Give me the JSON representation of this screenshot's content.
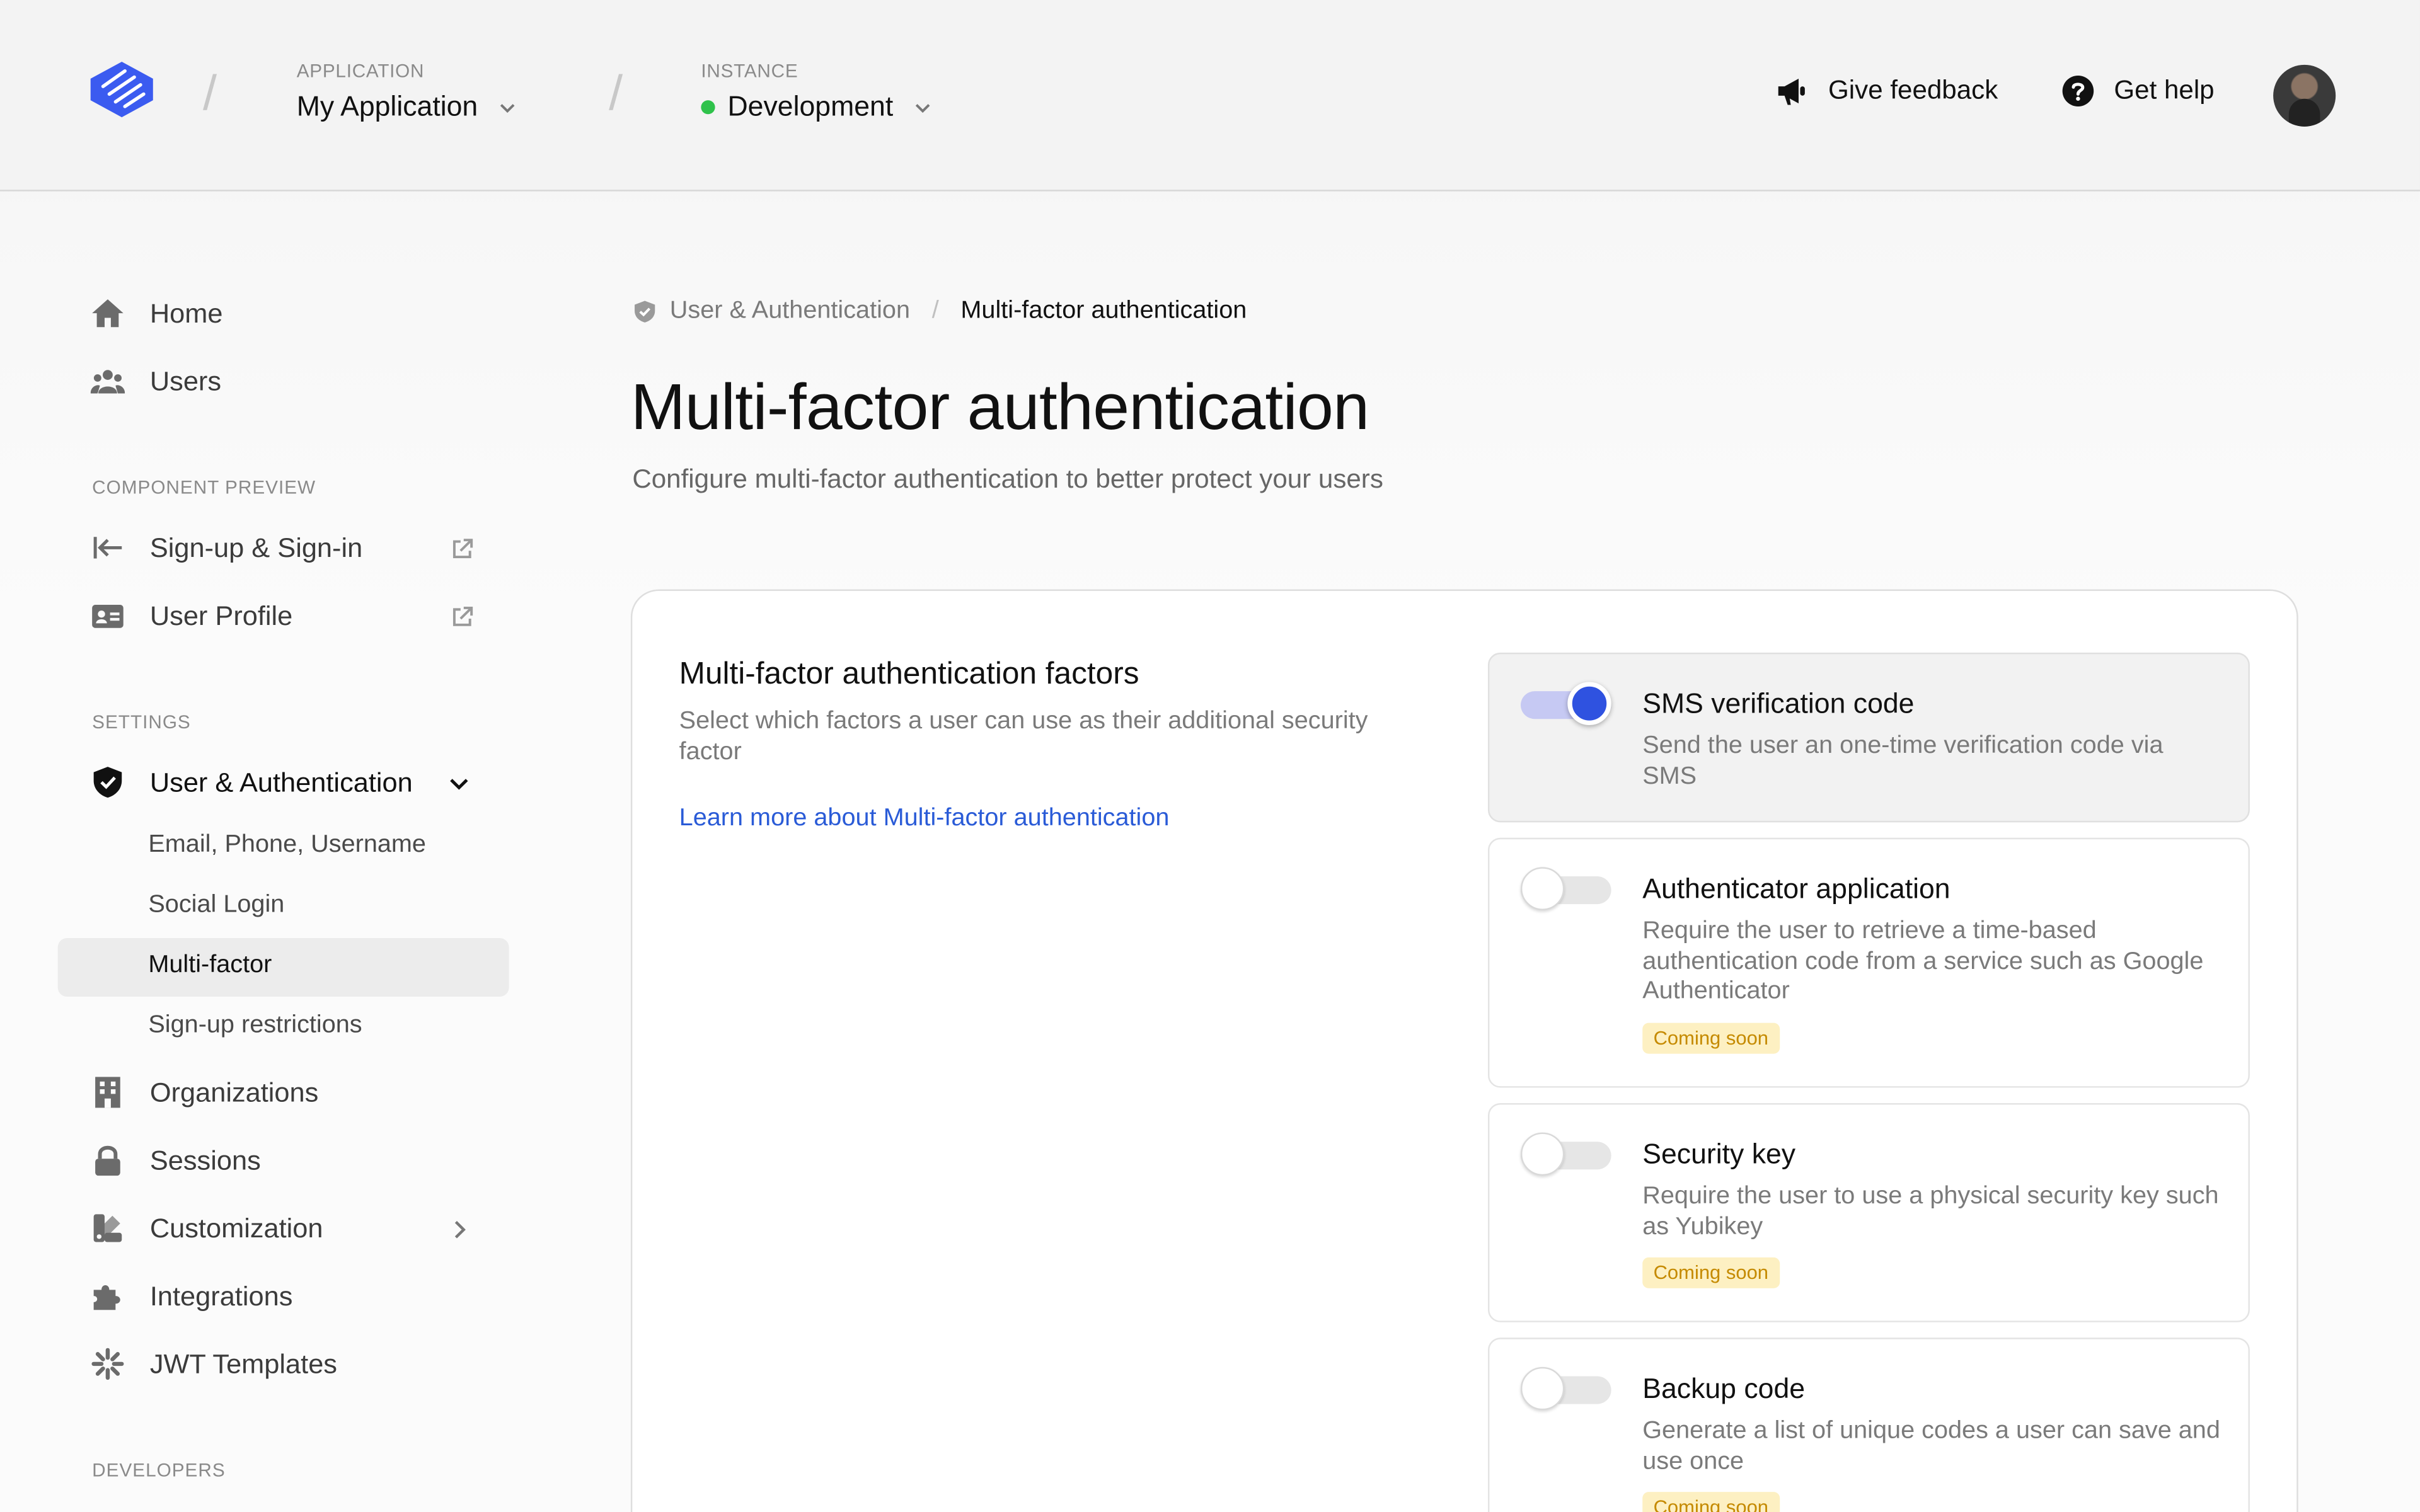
{
  "header": {
    "application": {
      "caption": "APPLICATION",
      "value": "My Application"
    },
    "instance": {
      "caption": "INSTANCE",
      "value": "Development",
      "status_color": "#2fc24b"
    },
    "feedback_label": "Give feedback",
    "help_label": "Get help"
  },
  "sidebar": {
    "top": [
      {
        "label": "Home",
        "icon": "home-icon"
      },
      {
        "label": "Users",
        "icon": "users-icon"
      }
    ],
    "component_preview": {
      "caption": "COMPONENT PREVIEW",
      "items": [
        {
          "label": "Sign-up & Sign-in",
          "icon": "sign-in-icon"
        },
        {
          "label": "User Profile",
          "icon": "profile-card-icon"
        }
      ]
    },
    "settings": {
      "caption": "SETTINGS",
      "group_label": "User & Authentication",
      "sub_items": [
        "Email, Phone, Username",
        "Social Login",
        "Multi-factor",
        "Sign-up restrictions"
      ],
      "active_sub_item": "Multi-factor",
      "items": [
        {
          "label": "Organizations",
          "icon": "building-icon"
        },
        {
          "label": "Sessions",
          "icon": "lock-icon"
        },
        {
          "label": "Customization",
          "icon": "palette-icon"
        },
        {
          "label": "Integrations",
          "icon": "puzzle-icon"
        },
        {
          "label": "JWT Templates",
          "icon": "jwt-icon"
        }
      ]
    },
    "developers_caption": "DEVELOPERS"
  },
  "main": {
    "breadcrumb": [
      "User & Authentication",
      "Multi-factor authentication"
    ],
    "title": "Multi-factor authentication",
    "subtitle": "Configure multi-factor authentication to better protect your users",
    "factors": {
      "title": "Multi-factor authentication factors",
      "description": "Select which factors a user can use as their additional security factor",
      "learn_more": "Learn more about Multi-factor authentication",
      "items": [
        {
          "title": "SMS verification code",
          "description": "Send the user an one-time verification code via SMS",
          "enabled": true
        },
        {
          "title": "Authenticator application",
          "description": "Require the user to retrieve a time-based authentication code from a service such as Google Authenticator",
          "enabled": false,
          "badge": "Coming soon"
        },
        {
          "title": "Security key",
          "description": "Require the user to use a physical security key such as Yubikey",
          "enabled": false,
          "badge": "Coming soon"
        },
        {
          "title": "Backup code",
          "description": "Generate a list of unique codes a user can save and use once",
          "enabled": false,
          "badge": "Coming soon"
        }
      ]
    }
  },
  "colors": {
    "accent": "#2f52e0",
    "link": "#2a5bd7",
    "badge_bg": "#fdf0c2",
    "badge_text": "#c58a00"
  }
}
